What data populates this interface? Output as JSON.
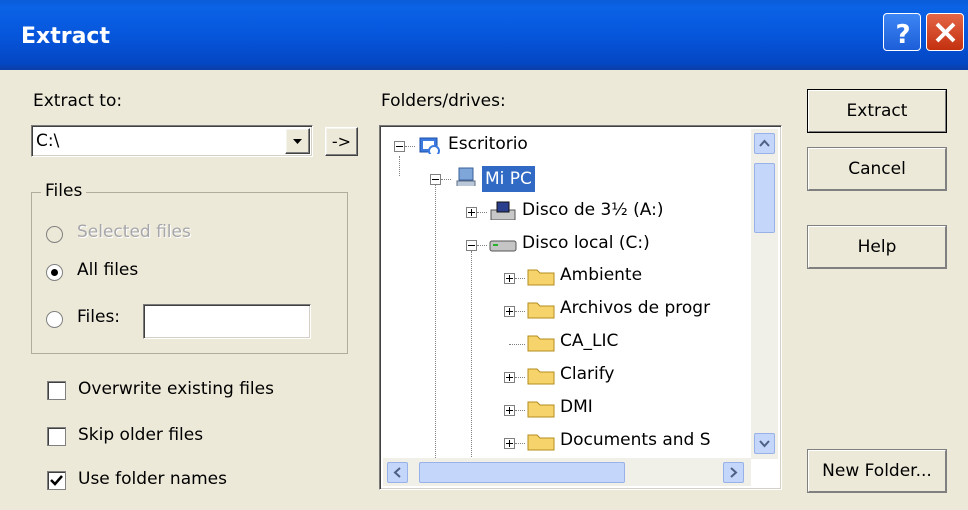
{
  "dialog": {
    "title": "Extract",
    "title_colors": {
      "bar": "#0556dc",
      "close": "#d43c1b"
    }
  },
  "extract_to": {
    "label": "Extract to:",
    "value": "C:\\",
    "go_button": "->"
  },
  "files_group": {
    "legend": "Files",
    "options": [
      {
        "label": "Selected files",
        "selected": false,
        "enabled": false
      },
      {
        "label": "All files",
        "selected": true,
        "enabled": true
      },
      {
        "label": "Files:",
        "selected": false,
        "enabled": true
      }
    ],
    "files_value": ""
  },
  "checkboxes": [
    {
      "label": "Overwrite existing files",
      "checked": false
    },
    {
      "label": "Skip older files",
      "checked": false
    },
    {
      "label": "Use folder names",
      "checked": true
    }
  ],
  "folders": {
    "label": "Folders/drives:",
    "tree": [
      {
        "label": "Escritorio",
        "icon": "desktop-icon"
      },
      {
        "label": "Mi PC",
        "icon": "my-computer-icon",
        "selected": true
      },
      {
        "label": "Disco de 3½ (A:)",
        "icon": "floppy-drive-icon"
      },
      {
        "label": "Disco local (C:)",
        "icon": "hard-drive-icon"
      },
      {
        "label": "Ambiente",
        "icon": "folder-icon"
      },
      {
        "label": "Archivos de progr",
        "icon": "folder-icon"
      },
      {
        "label": "CA_LIC",
        "icon": "folder-icon"
      },
      {
        "label": "Clarify",
        "icon": "folder-icon"
      },
      {
        "label": "DMI",
        "icon": "folder-icon"
      },
      {
        "label": "Documents and S",
        "icon": "folder-icon"
      }
    ]
  },
  "buttons": {
    "extract": "Extract",
    "cancel": "Cancel",
    "help": "Help",
    "new_folder": "New Folder..."
  }
}
